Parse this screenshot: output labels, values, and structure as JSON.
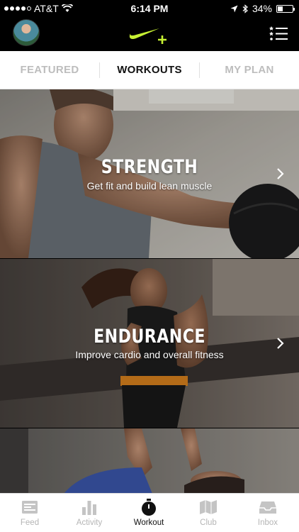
{
  "status_bar": {
    "carrier": "AT&T",
    "time": "6:14 PM",
    "battery": "34%",
    "battery_level": 0.34
  },
  "header": {
    "logo_icon": "nike-plus-logo-icon",
    "menu_icon": "list-menu-icon",
    "accent_color": "#c6f033"
  },
  "tabs": [
    {
      "label": "FEATURED",
      "active": false
    },
    {
      "label": "WORKOUTS",
      "active": true
    },
    {
      "label": "MY PLAN",
      "active": false
    }
  ],
  "workouts": [
    {
      "title": "STRENGTH",
      "subtitle": "Get fit and build lean muscle"
    },
    {
      "title": "ENDURANCE",
      "subtitle": "Improve cardio and overall fitness"
    },
    {
      "title": "",
      "subtitle": ""
    }
  ],
  "bottom_nav": [
    {
      "label": "Feed",
      "icon": "feed-icon",
      "active": false
    },
    {
      "label": "Activity",
      "icon": "activity-bars-icon",
      "active": false
    },
    {
      "label": "Workout",
      "icon": "stopwatch-icon",
      "active": true
    },
    {
      "label": "Club",
      "icon": "club-map-icon",
      "active": false
    },
    {
      "label": "Inbox",
      "icon": "inbox-tray-icon",
      "active": false
    }
  ]
}
